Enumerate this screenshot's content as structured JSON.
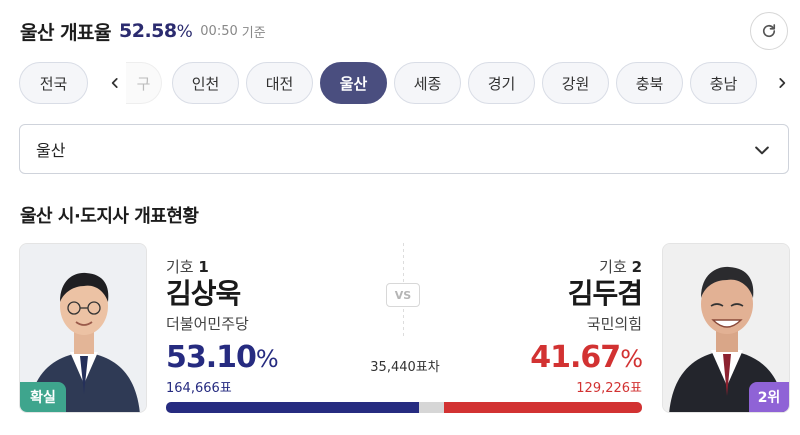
{
  "header": {
    "title": "울산 개표율",
    "rate_value": "52.58",
    "rate_unit": "%",
    "time": "00:50",
    "time_suffix": "기준"
  },
  "regions": {
    "first": "전국",
    "partial": "구",
    "items": [
      "인천",
      "대전",
      "울산",
      "세종",
      "경기",
      "강원",
      "충북",
      "충남"
    ],
    "active": "울산"
  },
  "select": {
    "value": "울산"
  },
  "section": {
    "title": "울산 시·도지사 개표현황"
  },
  "vs_label": "VS",
  "diff": "35,440표차",
  "candidates": [
    {
      "number_prefix": "기호",
      "number": "1",
      "name": "김상욱",
      "party": "더불어민주당",
      "percent": "53.10",
      "percent_unit": "%",
      "votes": "164,666표",
      "badge": "확실",
      "color": "#262b80",
      "badge_color": "#3ea58d"
    },
    {
      "number_prefix": "기호",
      "number": "2",
      "name": "김두겸",
      "party": "국민의힘",
      "percent": "41.67",
      "percent_unit": "%",
      "votes": "129,226표",
      "badge": "2위",
      "color": "#d23232",
      "badge_color": "#8f63d6"
    }
  ],
  "icons": {
    "refresh": "refresh-icon",
    "chevron_down": "chevron-down-icon",
    "chevron_left": "chevron-left-icon",
    "chevron_right": "chevron-right-icon"
  },
  "colors": {
    "active_chip": "#4a4e7f",
    "rate": "#2b2b6f"
  }
}
